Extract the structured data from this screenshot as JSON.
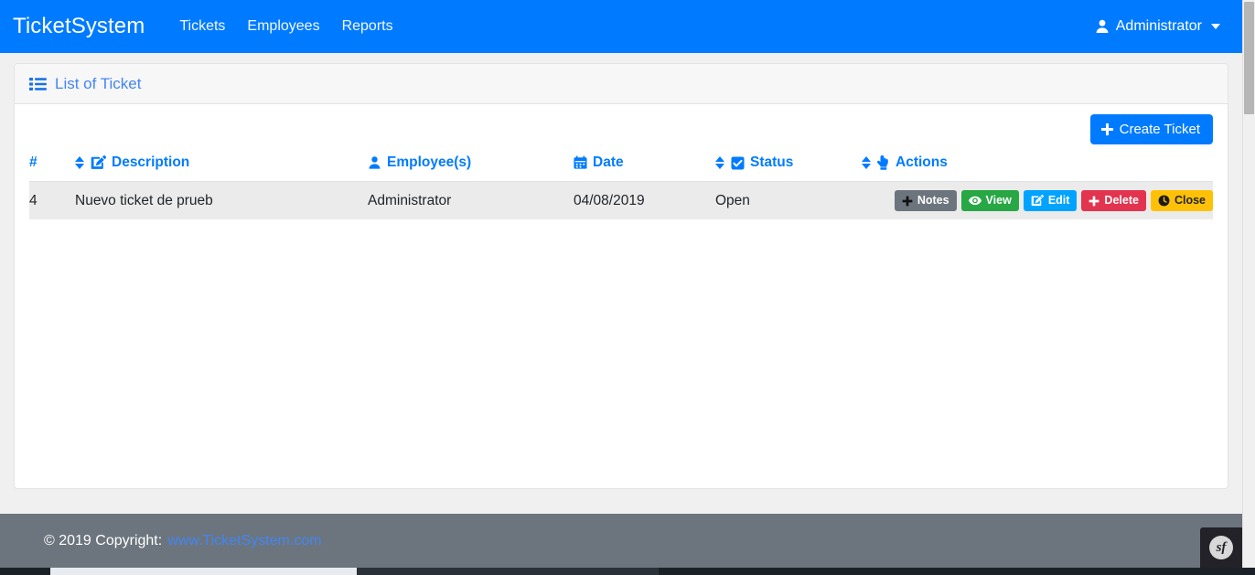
{
  "navbar": {
    "brand": "TicketSystem",
    "links": [
      {
        "label": "Tickets",
        "name": "nav-link-tickets"
      },
      {
        "label": "Employees",
        "name": "nav-link-employees"
      },
      {
        "label": "Reports",
        "name": "nav-link-reports"
      }
    ],
    "user": {
      "icon": "user-icon",
      "label": "Administrator",
      "caret": "chevron-down-icon"
    },
    "background_color": "#007bff"
  },
  "card": {
    "header": {
      "icon": "list-icon",
      "title": "List of Ticket",
      "title_color": "#4285f4"
    },
    "toolbar": {
      "create_button": {
        "label": "Create Ticket",
        "icon": "plus-icon",
        "color": "#007bff"
      }
    }
  },
  "table": {
    "columns": [
      {
        "key": "hash",
        "label": "#",
        "icon": null,
        "sortable": false
      },
      {
        "key": "desc",
        "label": "Description",
        "icon": "edit-icon",
        "sortable": true
      },
      {
        "key": "emp",
        "label": "Employee(s)",
        "icon": "user-icon",
        "sortable": false
      },
      {
        "key": "date",
        "label": "Date",
        "icon": "calendar-icon",
        "sortable": false
      },
      {
        "key": "status",
        "label": "Status",
        "icon": "checkbox-icon",
        "sortable": true
      },
      {
        "key": "act",
        "label": "Actions",
        "icon": "hand-icon",
        "sortable": true
      }
    ],
    "rows": [
      {
        "hash": "4",
        "desc": "Nuevo ticket de prueb",
        "emp": "Administrator",
        "date": "04/08/2019",
        "status": "Open",
        "actions": [
          {
            "label": "Notes",
            "icon": "plus-icon",
            "style": "notes",
            "color": "#6c757d"
          },
          {
            "label": "View",
            "icon": "eye-icon",
            "style": "view",
            "color": "#28a745"
          },
          {
            "label": "Edit",
            "icon": "edit-icon",
            "style": "edit",
            "color": "#00a3ff"
          },
          {
            "label": "Delete",
            "icon": "plus-icon",
            "style": "delete",
            "color": "#e3344f"
          },
          {
            "label": "Close",
            "icon": "clock-icon",
            "style": "close",
            "color": "#ffc107"
          }
        ]
      }
    ]
  },
  "footer": {
    "copyright": "© 2019 Copyright:",
    "link": "www.TicketSystem.com",
    "background_color": "#6c757d"
  },
  "debug_toolbar": {
    "logo_text": "sf"
  }
}
